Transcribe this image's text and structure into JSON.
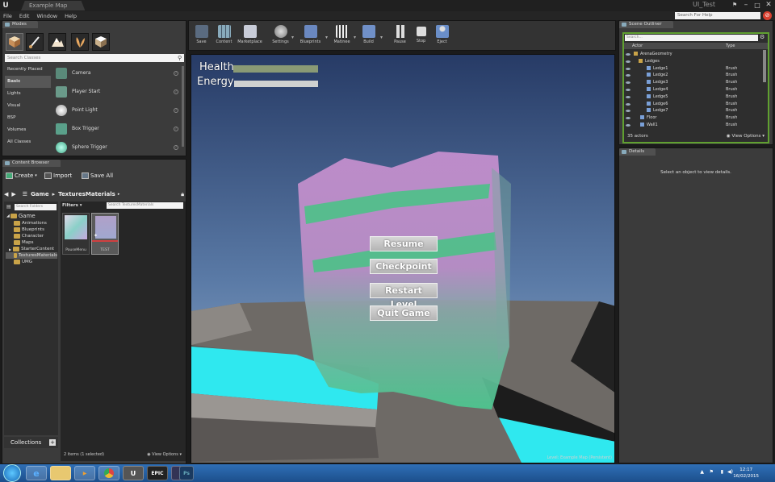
{
  "window": {
    "tab_title": "Example Map",
    "project": "UI_Test",
    "logo": "U"
  },
  "menu": {
    "items": [
      "File",
      "Edit",
      "Window",
      "Help"
    ],
    "search_placeholder": "Search For Help"
  },
  "modes": {
    "tab": "Modes",
    "search_placeholder": "Search Classes",
    "categories": [
      "Recently Placed",
      "Basic",
      "Lights",
      "Visual",
      "BSP",
      "Volumes",
      "All Classes"
    ],
    "classes": [
      "Camera",
      "Player Start",
      "Point Light",
      "Box Trigger",
      "Sphere Trigger"
    ]
  },
  "content_browser": {
    "tab": "Content Browser",
    "create": "Create",
    "import": "Import",
    "save_all": "Save All",
    "path": [
      "Game",
      "TexturesMaterials"
    ],
    "search_folders": "Search Folders",
    "folders": [
      "Game",
      "Animations",
      "Blueprints",
      "Character",
      "Maps",
      "StarterContent",
      "TexturesMaterials",
      "UMG"
    ],
    "filters": "Filters",
    "search_assets": "Search TexturesMaterials",
    "assets": [
      "PauseMenu",
      "TEST"
    ],
    "collections": "Collections",
    "status": "2 items (1 selected)",
    "view_options": "View Options"
  },
  "toolbar": {
    "buttons": [
      "Save",
      "Content",
      "Marketplace",
      "Settings",
      "Blueprints",
      "Matinee",
      "Build",
      "Pause",
      "Stop",
      "Eject"
    ]
  },
  "viewport": {
    "health_label": "Health",
    "energy_label": "Energy",
    "menu": [
      "Resume",
      "Checkpoint",
      "Restart Level",
      "Quit Game"
    ],
    "level": "Level:  Example Map (Persistent)"
  },
  "outliner": {
    "tab": "Scene Outliner",
    "search_placeholder": "Search...",
    "col_actor": "Actor",
    "col_type": "Type",
    "rows": [
      {
        "name": "ArenaGeometry",
        "type": ""
      },
      {
        "name": "Ledges",
        "type": ""
      },
      {
        "name": "Ledge1",
        "type": "Brush"
      },
      {
        "name": "Ledge2",
        "type": "Brush"
      },
      {
        "name": "Ledge3",
        "type": "Brush"
      },
      {
        "name": "Ledge4",
        "type": "Brush"
      },
      {
        "name": "Ledge5",
        "type": "Brush"
      },
      {
        "name": "Ledge6",
        "type": "Brush"
      },
      {
        "name": "Ledge7",
        "type": "Brush"
      },
      {
        "name": "Floor",
        "type": "Brush"
      },
      {
        "name": "Wall1",
        "type": "Brush"
      }
    ],
    "count": "35 actors",
    "view_options": "View Options"
  },
  "details": {
    "tab": "Details",
    "message": "Select an object to view details."
  },
  "taskbar": {
    "time": "12:17",
    "date": "16/02/2015",
    "epic_label": "EPIC",
    "ps_label": "Ps"
  }
}
